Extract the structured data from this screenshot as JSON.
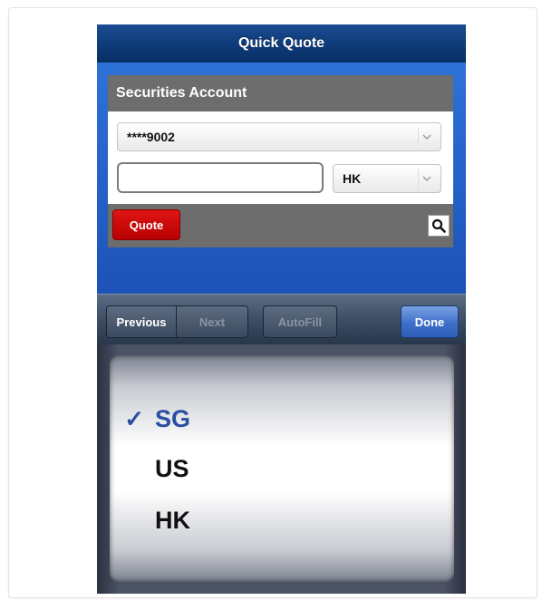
{
  "nav": {
    "title": "Quick Quote"
  },
  "account_panel": {
    "header": "Securities Account",
    "account_value": "****9002",
    "symbol_input": {
      "value": "",
      "placeholder": ""
    },
    "market_value": "HK",
    "quote_button": "Quote"
  },
  "toolbar": {
    "previous": "Previous",
    "next": "Next",
    "autofill": "AutoFill",
    "done": "Done"
  },
  "picker": {
    "items": [
      {
        "label": "SG",
        "checkmark": "✓"
      },
      {
        "label": "US"
      },
      {
        "label": "HK"
      }
    ]
  },
  "colors": {
    "nav_bar": "#0e3a78",
    "background_blue": "#1f57b8",
    "panel_gray": "#6d6d6d",
    "quote_red": "#c80000",
    "done_blue": "#3f6fc9",
    "selected_text": "#2a4fa0"
  },
  "icons": {
    "search": "search-icon",
    "dropdown": "chevron-down-icon",
    "check": "checkmark-icon"
  }
}
